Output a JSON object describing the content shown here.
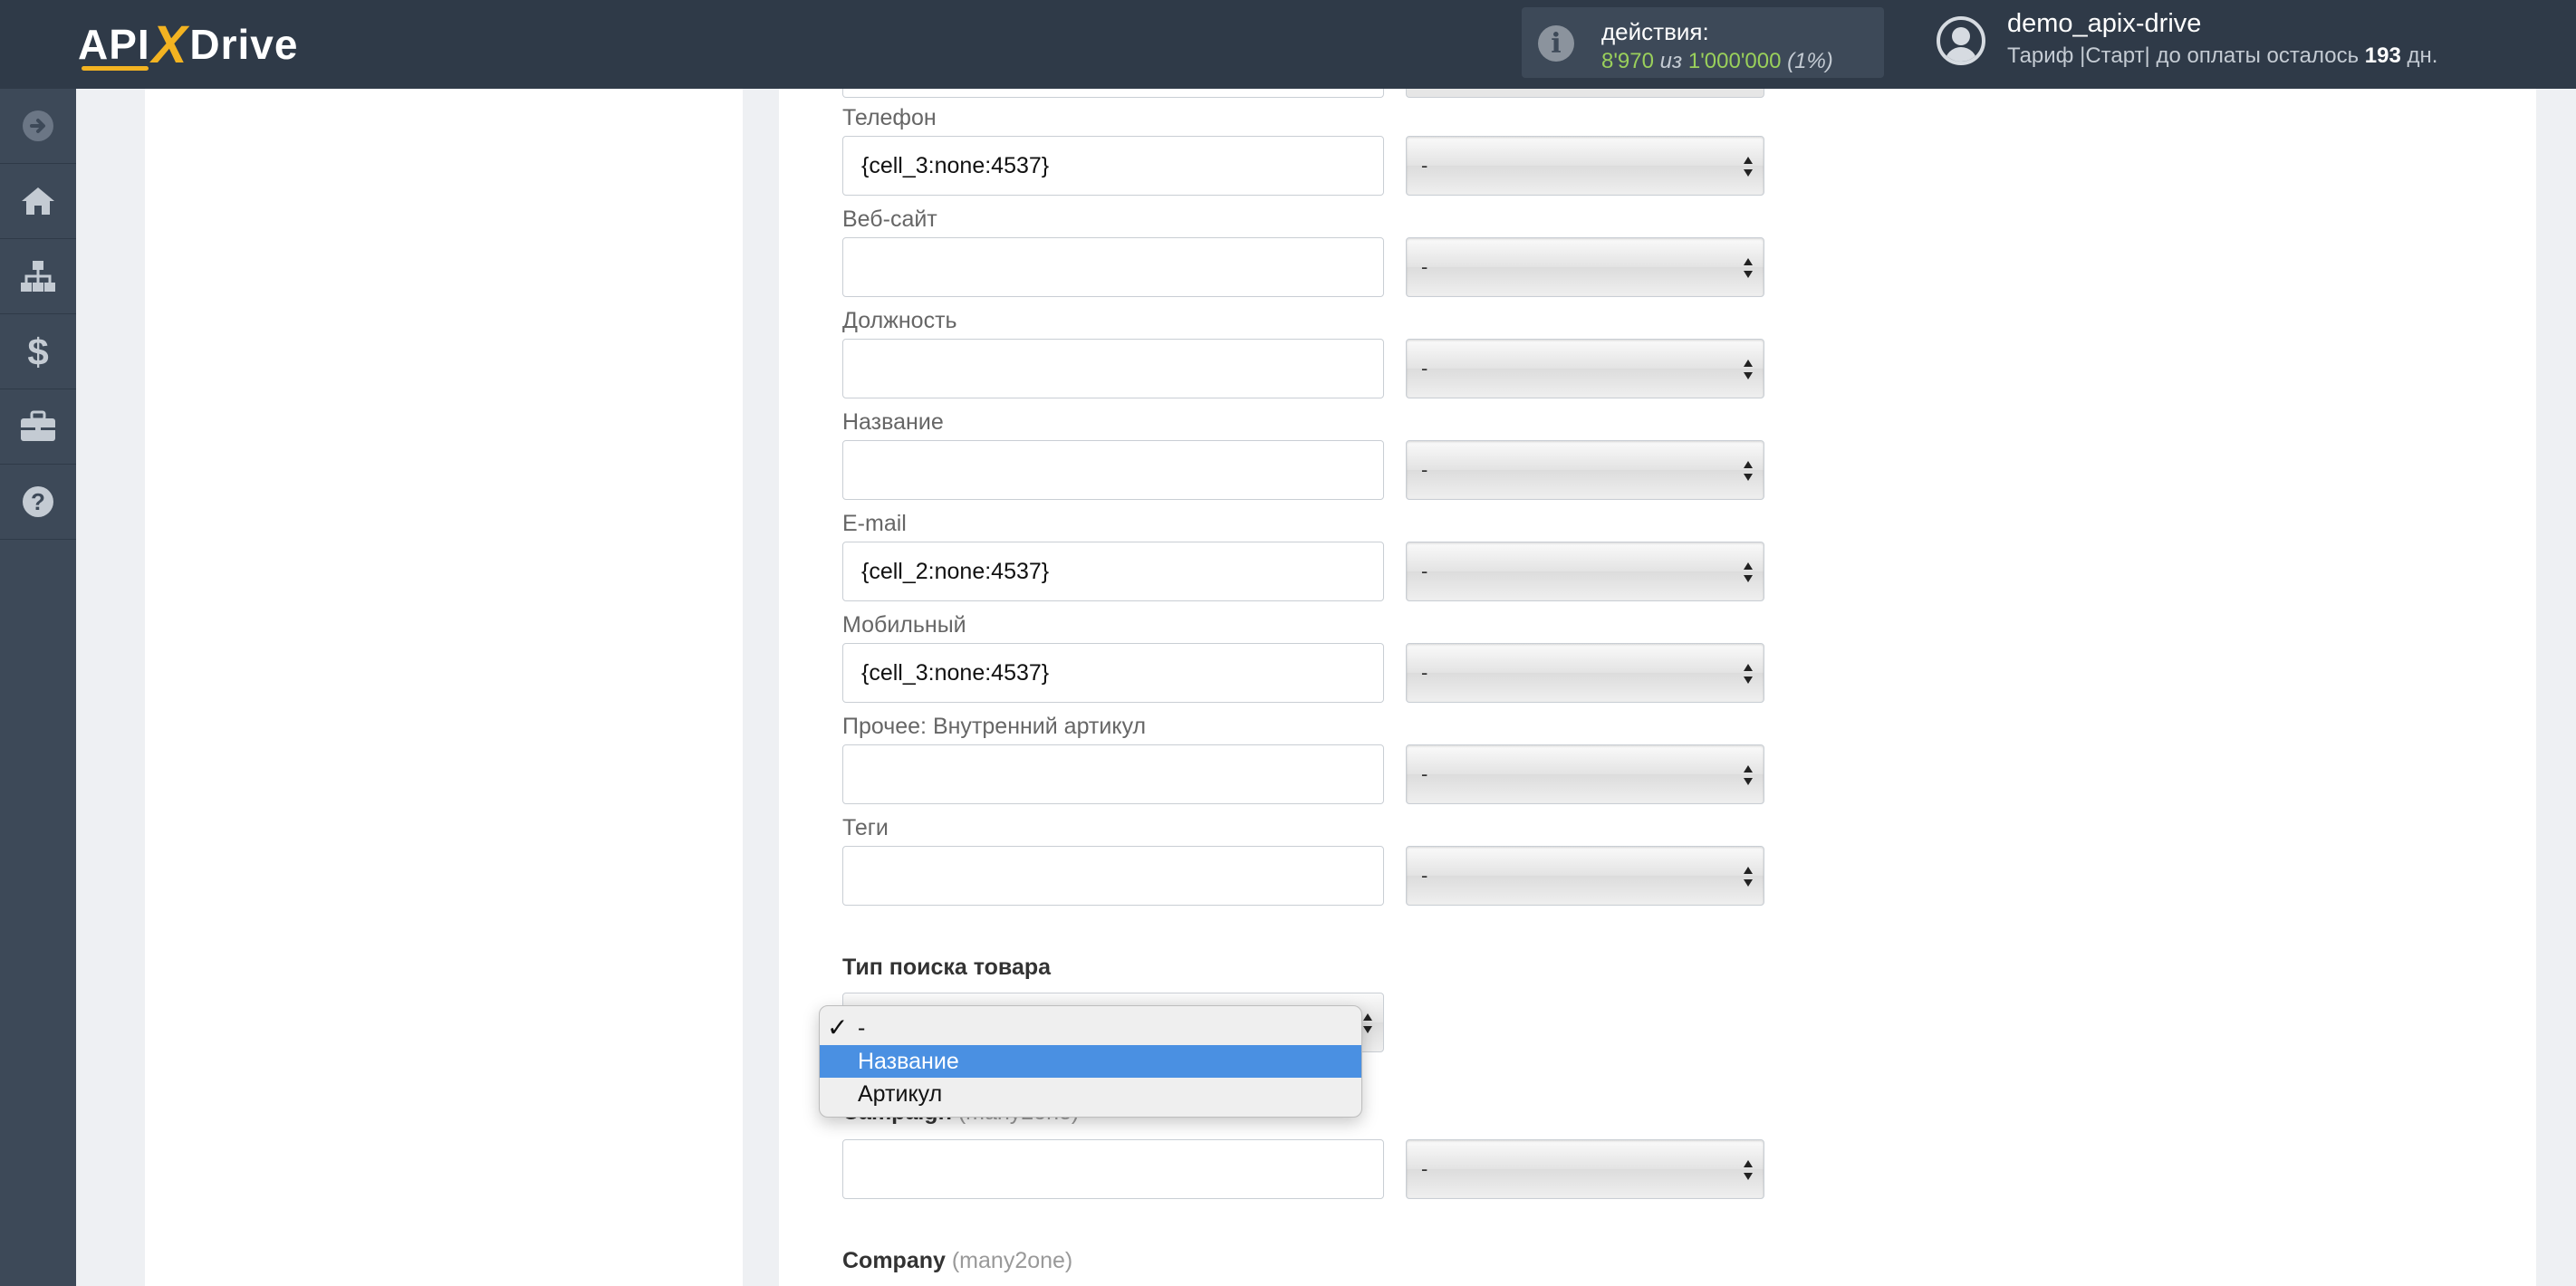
{
  "header": {
    "logo": {
      "api": "API",
      "x": "X",
      "drive": "Drive"
    },
    "actions": {
      "label": "действия:",
      "used": "8'970",
      "of": "из",
      "total": "1'000'000",
      "percent": "(1%)"
    },
    "user": {
      "name": "demo_apix-drive",
      "tariff_prefix": "Тариф |Старт| до оплаты осталось",
      "days": "193",
      "days_suffix": "дн."
    }
  },
  "sidebar": {
    "items": [
      {
        "icon": "arrow-right-circle-icon"
      },
      {
        "icon": "home-icon"
      },
      {
        "icon": "sitemap-icon"
      },
      {
        "icon": "dollar-icon"
      },
      {
        "icon": "briefcase-icon"
      },
      {
        "icon": "question-circle-icon"
      }
    ]
  },
  "form": {
    "fields": [
      {
        "label": "Телефон",
        "value": "{cell_3:none:4537}",
        "select": "-"
      },
      {
        "label": "Веб-сайт",
        "value": "",
        "select": "-"
      },
      {
        "label": "Должность",
        "value": "",
        "select": "-"
      },
      {
        "label": "Название",
        "value": "",
        "select": "-"
      },
      {
        "label": "E-mail",
        "value": "{cell_2:none:4537}",
        "select": "-"
      },
      {
        "label": "Мобильный",
        "value": "{cell_3:none:4537}",
        "select": "-"
      },
      {
        "label": "Прочее: Внутренний артикул",
        "value": "",
        "select": "-"
      },
      {
        "label": "Теги",
        "value": "",
        "select": "-"
      }
    ],
    "product_search": {
      "label": "Тип поиска товара",
      "options": [
        "-",
        "Название",
        "Артикул"
      ],
      "selected": "-",
      "highlighted": "Название"
    },
    "campaign": {
      "label": "Campaign",
      "hint": "(many2one)",
      "value": "",
      "select": "-"
    },
    "company": {
      "label": "Company",
      "hint": "(many2one)"
    }
  },
  "colors": {
    "topbar": "#2f3a48",
    "sidebar": "#3d4958",
    "accent_yellow": "#f3b321",
    "accent_green": "#9ad05b",
    "highlight_blue": "#4a90e2"
  }
}
